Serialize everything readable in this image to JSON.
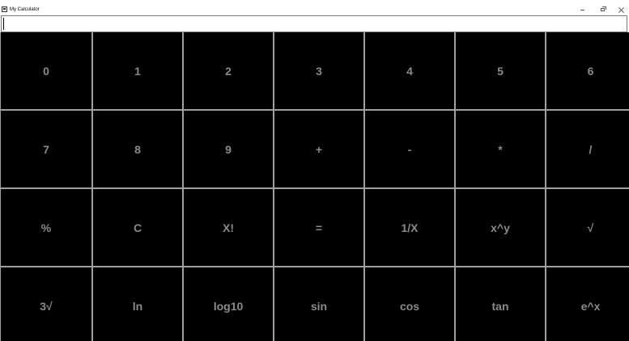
{
  "window": {
    "title": "My Calculator",
    "controls": {
      "minimize": "minimize-icon",
      "maximize": "maximize-icon",
      "close": "close-icon"
    }
  },
  "display": {
    "value": ""
  },
  "colors": {
    "key_background": "#000000",
    "key_text": "#8a8a8a",
    "grid_lines": "#a0a0a0"
  },
  "keys": [
    {
      "label": "0",
      "name": "key-0"
    },
    {
      "label": "1",
      "name": "key-1"
    },
    {
      "label": "2",
      "name": "key-2"
    },
    {
      "label": "3",
      "name": "key-3"
    },
    {
      "label": "4",
      "name": "key-4"
    },
    {
      "label": "5",
      "name": "key-5"
    },
    {
      "label": "6",
      "name": "key-6"
    },
    {
      "label": "7",
      "name": "key-7"
    },
    {
      "label": "8",
      "name": "key-8"
    },
    {
      "label": "9",
      "name": "key-9"
    },
    {
      "label": "+",
      "name": "key-plus"
    },
    {
      "label": "-",
      "name": "key-minus"
    },
    {
      "label": "*",
      "name": "key-multiply"
    },
    {
      "label": "/",
      "name": "key-divide"
    },
    {
      "label": "%",
      "name": "key-percent"
    },
    {
      "label": "C",
      "name": "key-clear"
    },
    {
      "label": "X!",
      "name": "key-factorial"
    },
    {
      "label": "=",
      "name": "key-equals"
    },
    {
      "label": "1/X",
      "name": "key-reciprocal"
    },
    {
      "label": "x^y",
      "name": "key-power"
    },
    {
      "label": "√",
      "name": "key-sqrt"
    },
    {
      "label": "3√",
      "name": "key-cube-root"
    },
    {
      "label": "ln",
      "name": "key-ln"
    },
    {
      "label": "log10",
      "name": "key-log10"
    },
    {
      "label": "sin",
      "name": "key-sin"
    },
    {
      "label": "cos",
      "name": "key-cos"
    },
    {
      "label": "tan",
      "name": "key-tan"
    },
    {
      "label": "e^x",
      "name": "key-exp"
    }
  ]
}
